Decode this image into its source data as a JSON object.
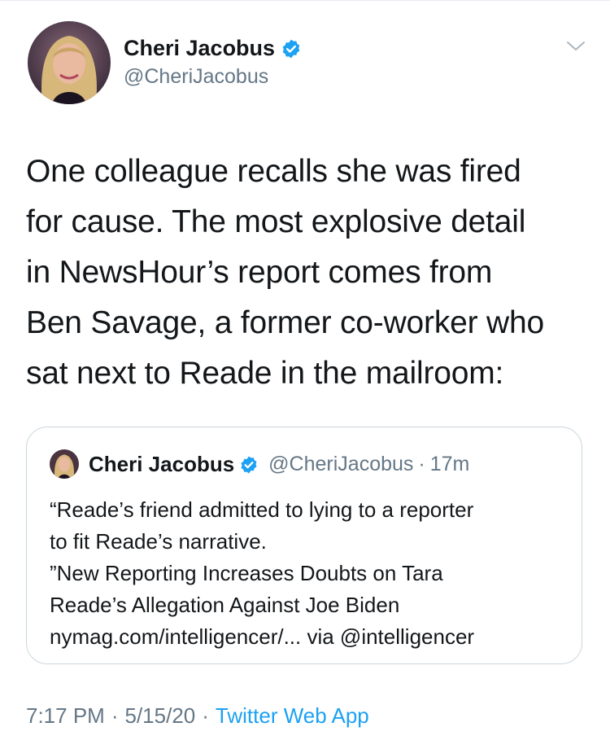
{
  "author": {
    "name": "Cheri Jacobus",
    "handle": "@CheriJacobus",
    "verified": true,
    "avatar_icon": "profile-photo"
  },
  "tweet": {
    "lines": [
      "One colleague recalls she was fired",
      "for cause. The most explosive detail",
      "in NewsHour’s report comes from",
      "Ben Savage, a former co-worker who",
      "sat next to Reade in the mailroom:"
    ]
  },
  "quoted_tweet": {
    "name": "Cheri Jacobus",
    "handle": "@CheriJacobus",
    "separator": "·",
    "time": "17m",
    "verified": true,
    "lines": [
      "“Reade’s friend admitted to lying to a reporter",
      "to fit Reade’s narrative.",
      "”New Reporting Increases Doubts on Tara",
      "Reade’s Allegation Against Joe Biden",
      "nymag.com/intelligencer/... via @intelligencer"
    ]
  },
  "meta": {
    "time": "7:17 PM",
    "date": "5/15/20",
    "separator": "·",
    "app": "Twitter Web App"
  },
  "colors": {
    "accent": "#1da1f2",
    "text": "#14171a",
    "secondary": "#657786",
    "border": "#ccd6dd"
  }
}
